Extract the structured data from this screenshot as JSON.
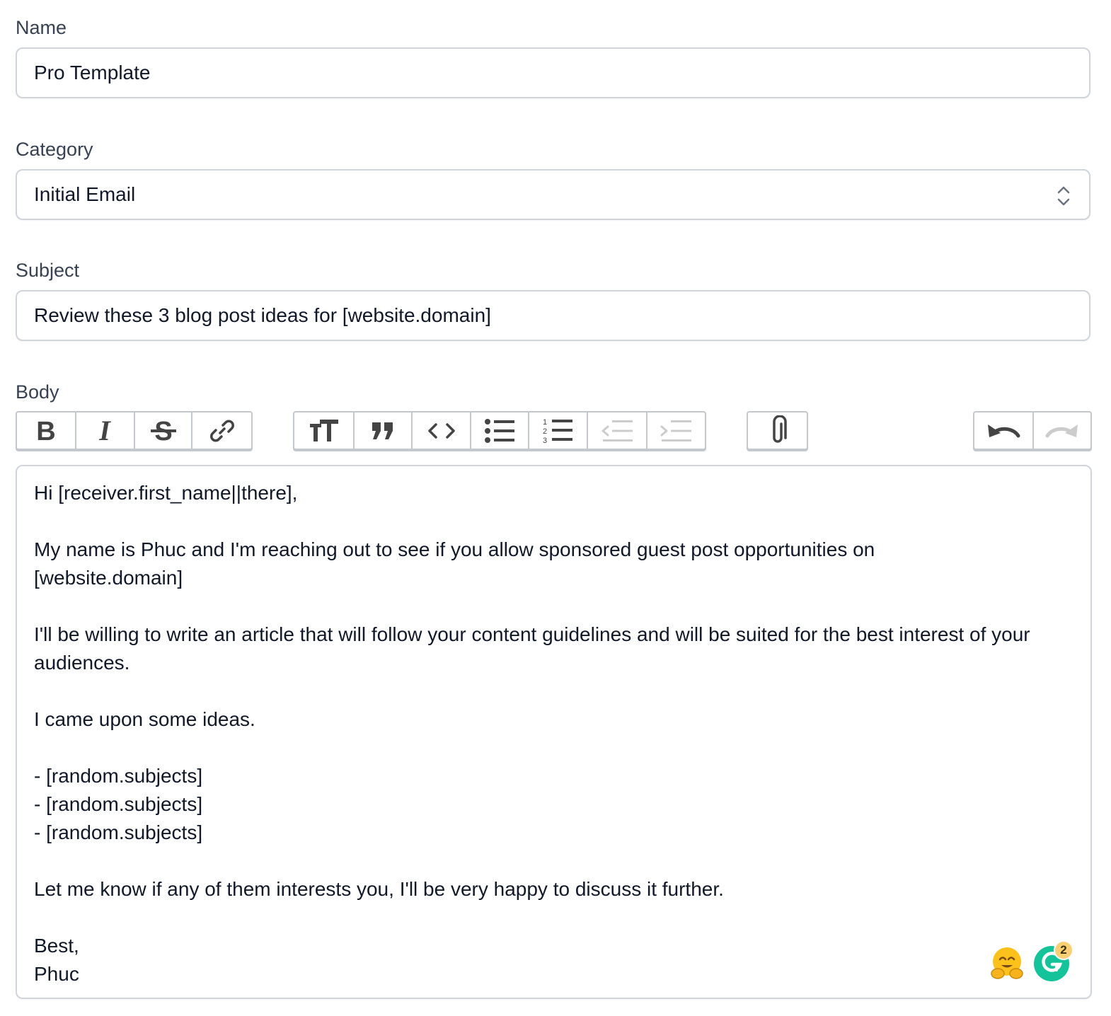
{
  "form": {
    "name": {
      "label": "Name",
      "value": "Pro Template"
    },
    "category": {
      "label": "Category",
      "value": "Initial Email"
    },
    "subject": {
      "label": "Subject",
      "value": "Review these 3 blog post ideas for [website.domain]"
    },
    "body": {
      "label": "Body",
      "content": "Hi [receiver.first_name||there],\n\nMy name is Phuc and I'm reaching out to see if you allow sponsored guest post opportunities on\n[website.domain]\n\nI'll be willing to write an article that will follow your content guidelines and will be suited for the best interest of your audiences.\n\nI came upon some ideas.\n\n- [random.subjects]\n- [random.subjects]\n- [random.subjects]\n\nLet me know if any of them interests you, I'll be very happy to discuss it further.\n\nBest,\nPhuc"
    }
  },
  "toolbar": {
    "text_group": [
      "bold-icon",
      "italic-icon",
      "strikethrough-icon",
      "link-icon"
    ],
    "block_group": [
      "heading-icon",
      "quote-icon",
      "code-icon",
      "bullet-list-icon",
      "numbered-list-icon",
      "outdent-icon",
      "indent-icon"
    ],
    "file_group": [
      "attach-icon"
    ],
    "history_group": [
      "undo-icon",
      "redo-icon"
    ]
  },
  "widgets": {
    "grammarly_count": "2"
  },
  "colors": {
    "icon_active": "#444444",
    "icon_disabled": "#cccccc",
    "grammarly": "#15c39a",
    "badge": "#fbd074"
  }
}
